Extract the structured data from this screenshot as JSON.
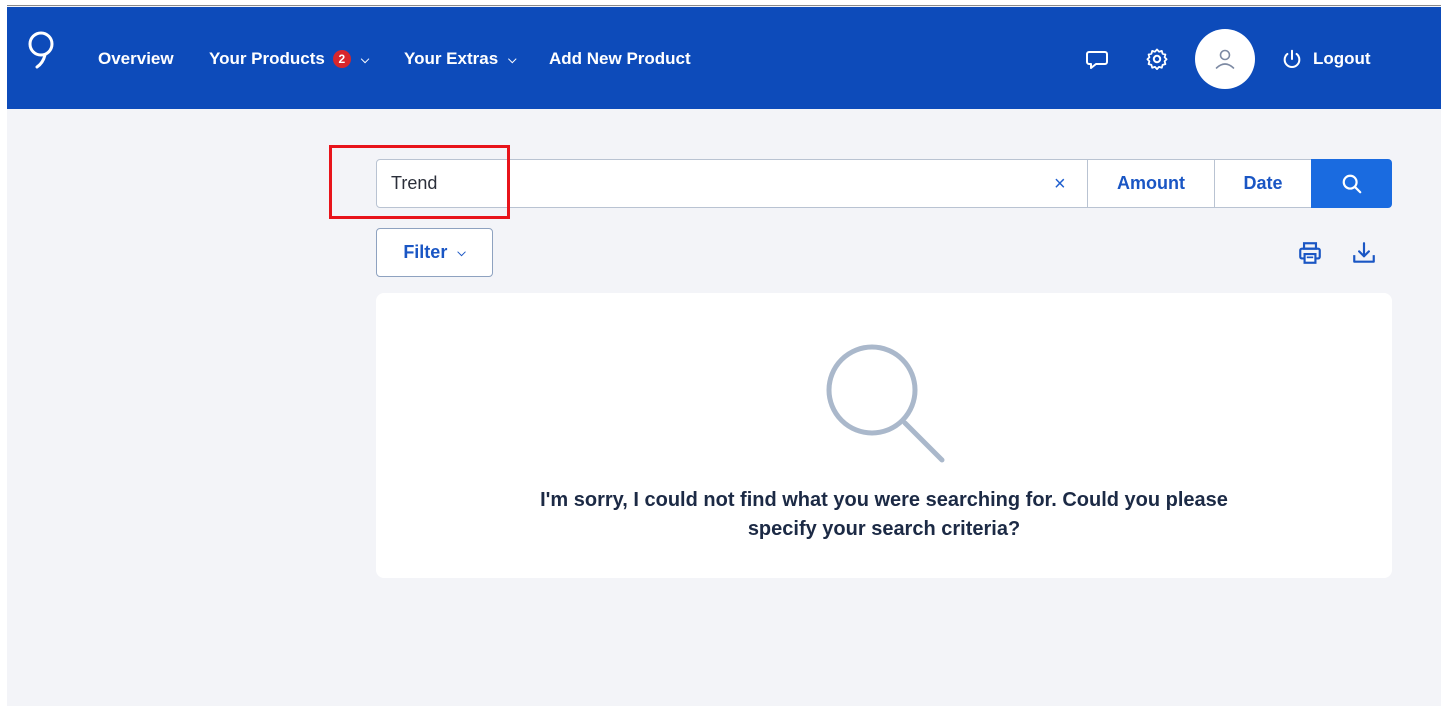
{
  "nav": {
    "items": [
      {
        "label": "Overview"
      },
      {
        "label": "Your Products",
        "badge": "2"
      },
      {
        "label": "Your Extras"
      },
      {
        "label": "Add New Product"
      }
    ],
    "logout": "Logout"
  },
  "search": {
    "value": "Trend",
    "clear": "×",
    "amount_label": "Amount",
    "date_label": "Date"
  },
  "filter": {
    "label": "Filter"
  },
  "results": {
    "empty_line1": "I'm sorry, I could not find what you were searching for. Could you please",
    "empty_line2": "specify your search criteria?"
  },
  "colors": {
    "brand": "#0d4bba",
    "accent": "#1a6be0",
    "badge": "#d7262c",
    "highlight": "#e8141b"
  },
  "icons": [
    "logo-icon",
    "chat-icon",
    "gear-icon",
    "user-icon",
    "power-icon",
    "close-icon",
    "search-icon",
    "printer-icon",
    "download-icon",
    "chevron-down-icon"
  ]
}
